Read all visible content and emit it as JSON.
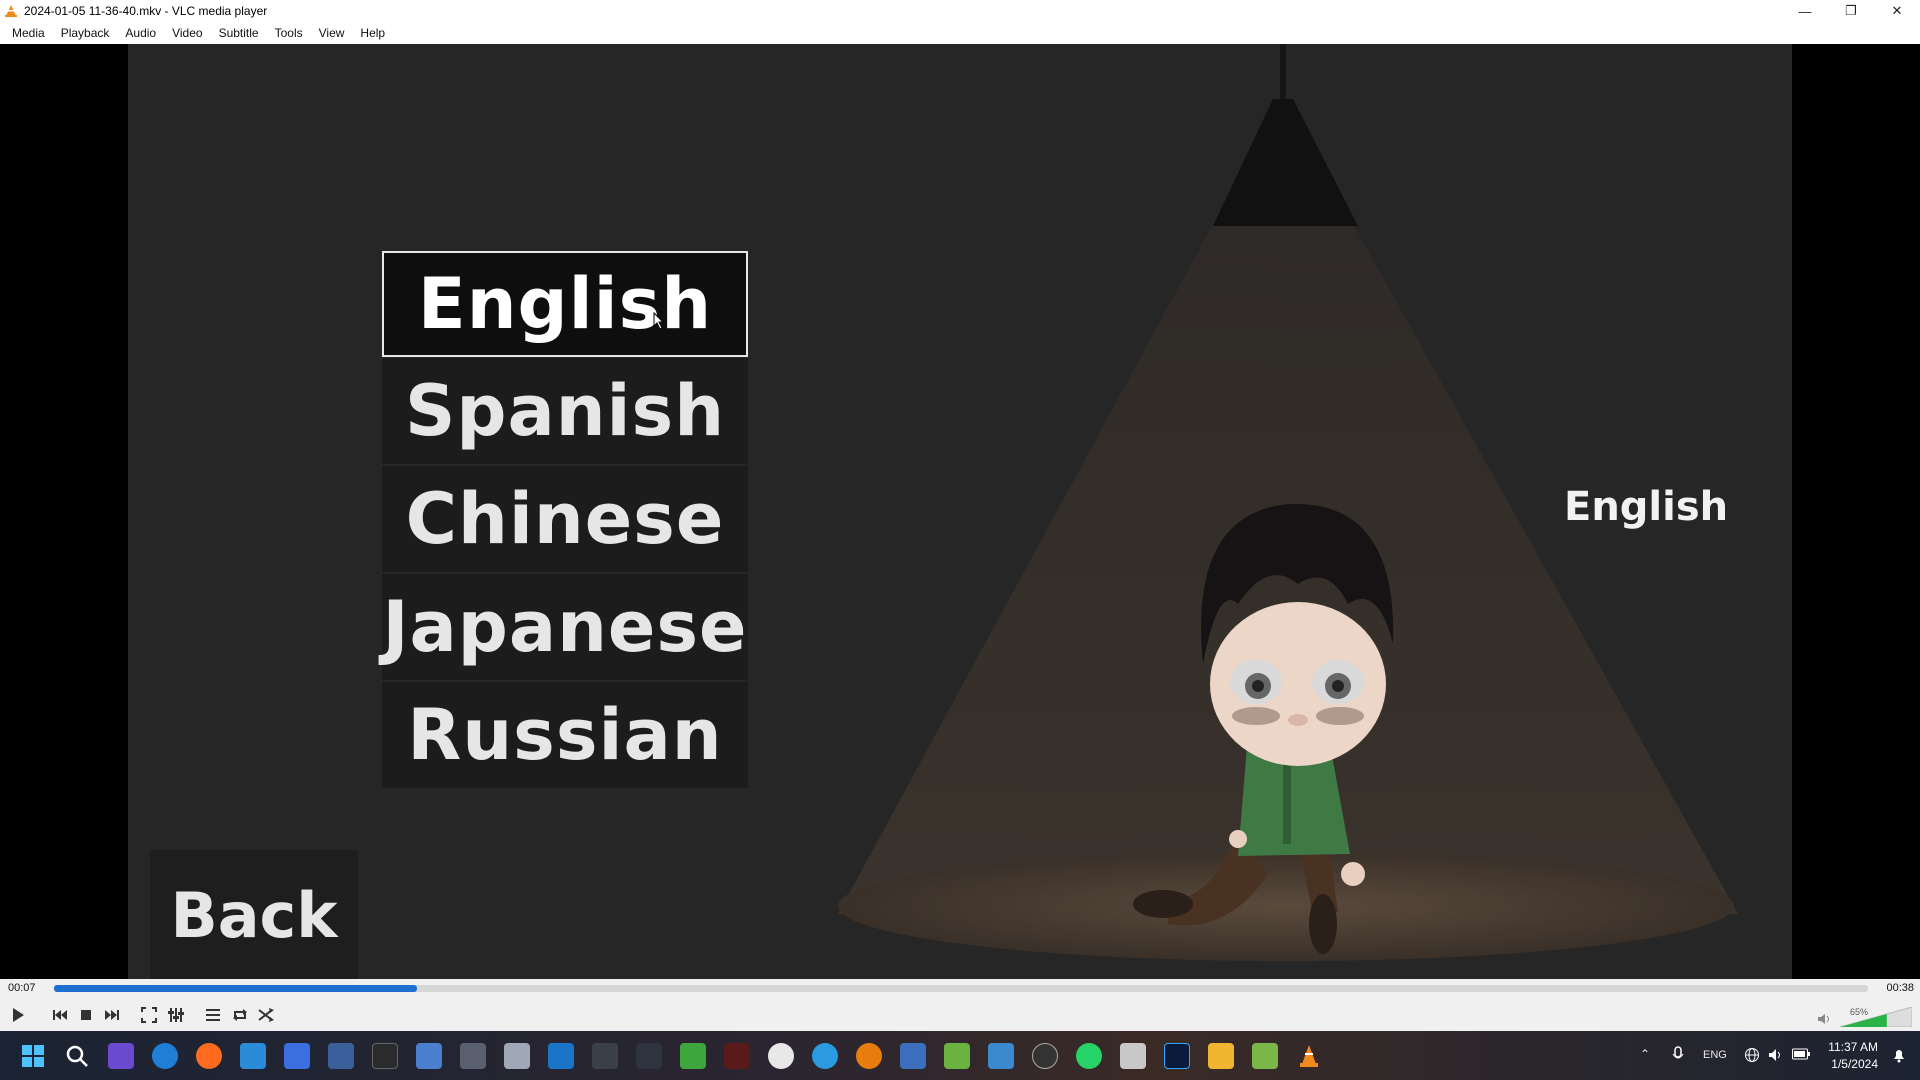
{
  "window": {
    "title": "2024-01-05 11-36-40.mkv - VLC media player"
  },
  "menu": [
    "Media",
    "Playback",
    "Audio",
    "Video",
    "Subtitle",
    "Tools",
    "View",
    "Help"
  ],
  "game": {
    "languages": [
      "English",
      "Spanish",
      "Chinese",
      "Japanese",
      "Russian"
    ],
    "selected_language": "English",
    "back_label": "Back",
    "current_language_display": "English"
  },
  "player": {
    "elapsed": "00:07",
    "total": "00:38",
    "progress": 0.2,
    "volume_label": "65%",
    "volume": 0.65
  },
  "taskbar": {
    "tray_language": "ENG",
    "clock_time": "11:37 AM",
    "clock_date": "1/5/2024"
  },
  "colors": {
    "accent": "#1e6fd0",
    "vlc_orange": "#f08a1c"
  }
}
